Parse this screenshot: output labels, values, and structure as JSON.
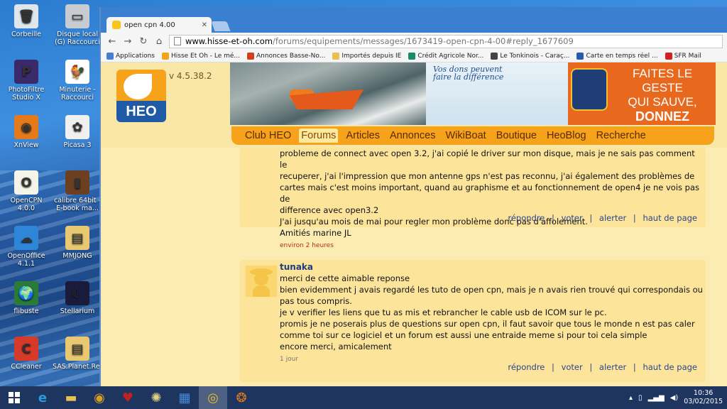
{
  "desktop": {
    "icons": [
      {
        "label": "Corbeille",
        "glyph": "🗑",
        "color": "#dfe6ee"
      },
      {
        "label": "Disque local (G) Raccourci",
        "glyph": "▭",
        "color": "#c8ccd2"
      },
      {
        "label": "PhotoFiltre Studio X",
        "glyph": "P",
        "color": "#3a2a6a"
      },
      {
        "label": "Minuterie - Raccourci",
        "glyph": "🐓",
        "color": "#ffffff"
      },
      {
        "label": "XnView",
        "glyph": "◉",
        "color": "#e47a1c"
      },
      {
        "label": "Picasa 3",
        "glyph": "✿",
        "color": "#f0f0f0"
      },
      {
        "label": "OpenCPN 4.0.0",
        "glyph": "O",
        "color": "#f4f4e8"
      },
      {
        "label": "calibre 64bit - E-book ma...",
        "glyph": "▮",
        "color": "#6a4020"
      },
      {
        "label": "OpenOffice 4.1.1",
        "glyph": "☁",
        "color": "#2e86d8"
      },
      {
        "label": "MMJONG",
        "glyph": "▤",
        "color": "#e8c870"
      },
      {
        "label": "flibuste",
        "glyph": "🌍",
        "color": "#2a7a3a"
      },
      {
        "label": "Stellarium",
        "glyph": "☾",
        "color": "#1a1a3a"
      },
      {
        "label": "CCleaner",
        "glyph": "C",
        "color": "#d83a2a"
      },
      {
        "label": "SAS.Planet.Rele...",
        "glyph": "▤",
        "color": "#e8c870"
      }
    ]
  },
  "browser": {
    "tab_title": "open cpn 4.00",
    "url_host": "www.hisse-et-oh.com",
    "url_path": "/forums/equipements/messages/1673419-open-cpn-4-00#reply_1677609",
    "bookmarks": [
      {
        "label": "Applications",
        "color": "#4a7fd0"
      },
      {
        "label": "Hisse Et Oh - Le mé...",
        "color": "#f6a21a"
      },
      {
        "label": "Annonces Basse-No...",
        "color": "#d04020"
      },
      {
        "label": "Importés depuis IE",
        "color": "#e8c050"
      },
      {
        "label": "Crédit Agricole Nor...",
        "color": "#1a8a6a"
      },
      {
        "label": "Le Tonkinois - Caraç...",
        "color": "#444444"
      },
      {
        "label": "Carte en temps réel ...",
        "color": "#2a5ab0"
      },
      {
        "label": "SFR Mail",
        "color": "#d02020"
      }
    ]
  },
  "site": {
    "logo_text": "HEO",
    "version": "v 4.5.38.2",
    "banner_slogan_1": "Vos dons peuvent",
    "banner_slogan_2": "faire la différence",
    "banner_cta_1": "FAITES LE GESTE",
    "banner_cta_2": "QUI SAUVE,",
    "banner_cta_3": "DONNEZ",
    "menu": [
      "Club HEO",
      "Forums",
      "Articles",
      "Annonces",
      "WikiBoat",
      "Boutique",
      "HeoBlog",
      "Recherche"
    ],
    "active_menu": "Forums"
  },
  "posts": [
    {
      "lines": [
        "probleme de connect avec open 3.2, j'ai copié le driver sur mon disque, mais je ne sais pas comment le",
        "recuperer, j'ai l'impression que mon antenne gps n'est pas reconnu, j'ai également des problèmes de",
        "cartes mais c'est moins important, quand au graphisme et au fonctionnement de open4 je ne vois pas de",
        "difference avec open3.2",
        "J'ai jusqu'au mois de mai pour regler mon problème donc pas d'affolement.",
        "Amitiés marine JL"
      ],
      "time": "environ 2 heures"
    },
    {
      "author": "tunaka",
      "lines": [
        "merci de cette aimable reponse",
        "bien evidemment j avais regardé les tuto de open cpn, mais je n avais rien trouvé qui correspondais ou",
        "pas tous compris.",
        "je v verifier les liens que tu as mis et rebrancher le cable usb de ICOM sur le pc.",
        "promis je ne poserais plus de questions sur open cpn, il faut savoir que tous le monde n est pas caler",
        "comme toi sur ce logiciel et un forum est aussi une entraide meme si pour toi cela simple",
        "encore merci, amicalement"
      ],
      "time": "1 jour"
    }
  ],
  "actions": {
    "reply": "répondre",
    "vote": "voter",
    "alert": "alerter",
    "top": "haut de page",
    "sep": "|"
  },
  "taskbar": {
    "time": "10:36",
    "date": "03/02/2015",
    "items": [
      {
        "name": "internet-explorer",
        "glyph": "e",
        "color": "#2a9ae0"
      },
      {
        "name": "file-explorer",
        "glyph": "▬",
        "color": "#e8c050"
      },
      {
        "name": "app-1",
        "glyph": "◉",
        "color": "#d8a020"
      },
      {
        "name": "app-2",
        "glyph": "♥",
        "color": "#c02020"
      },
      {
        "name": "app-3",
        "glyph": "✺",
        "color": "#e0d080"
      },
      {
        "name": "app-4",
        "glyph": "▦",
        "color": "#4a8ad8"
      },
      {
        "name": "chrome",
        "glyph": "◎",
        "color": "#e8c020"
      },
      {
        "name": "app-5",
        "glyph": "❂",
        "color": "#e47a1c"
      }
    ]
  }
}
